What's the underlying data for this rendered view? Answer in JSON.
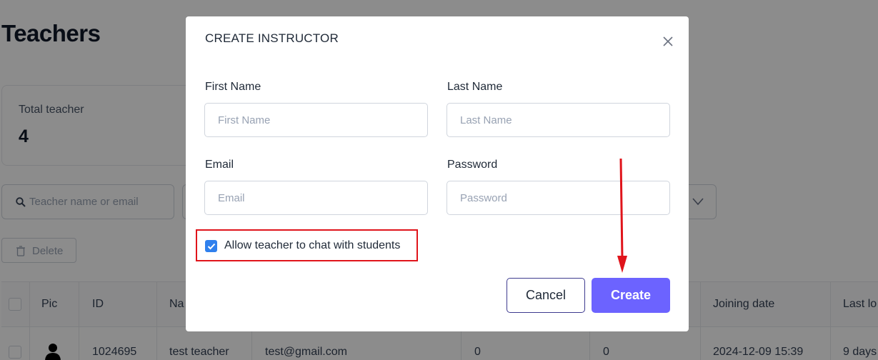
{
  "page": {
    "title": "Teachers",
    "stat": {
      "label": "Total teacher",
      "value": "4"
    },
    "search": {
      "placeholder": "Teacher name or email"
    },
    "delete_label": "Delete",
    "table": {
      "headers": [
        "Pic",
        "ID",
        "Na",
        "Joining date",
        "Last lo"
      ],
      "row": {
        "id": "1024695",
        "name": "test teacher",
        "email": "test@gmail.com",
        "col_a": "0",
        "col_b": "0",
        "joining_date": "2024-12-09 15:39",
        "last_login": "9 days"
      }
    }
  },
  "modal": {
    "title": "CREATE INSTRUCTOR",
    "first_name": {
      "label": "First Name",
      "placeholder": "First Name",
      "value": ""
    },
    "last_name": {
      "label": "Last Name",
      "placeholder": "Last Name",
      "value": ""
    },
    "email": {
      "label": "Email",
      "placeholder": "Email",
      "value": ""
    },
    "password": {
      "label": "Password",
      "placeholder": "Password",
      "value": ""
    },
    "chat_option": {
      "label": "Allow teacher to chat with students",
      "checked": true
    },
    "cancel_label": "Cancel",
    "create_label": "Create"
  },
  "icons": {
    "close": "close-icon",
    "search": "search-icon",
    "trash": "trash-icon",
    "chevron": "chevron-down-icon",
    "check": "check-icon",
    "avatar": "person-icon"
  },
  "colors": {
    "primary": "#6c63ff",
    "cancel_border": "#3e3b8f",
    "checkbox": "#2f80ed",
    "highlight": "#e0141b",
    "overlay": "rgba(0,0,0,0.45)"
  }
}
